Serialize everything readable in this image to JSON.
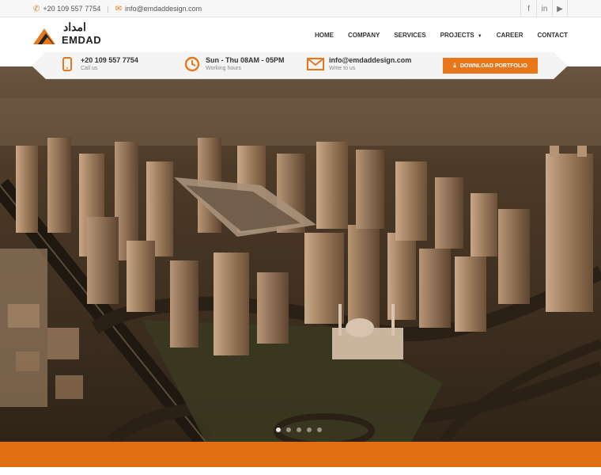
{
  "topbar": {
    "phone": "+20 109 557 7754",
    "email": "info@emdaddesign.com",
    "social": [
      "facebook-icon",
      "linkedin-icon",
      "youtube-icon"
    ],
    "social_glyphs": [
      "f",
      "in",
      "▶"
    ]
  },
  "header": {
    "logo_arabic": "امداد",
    "logo_latin": "EMDAD",
    "nav": [
      {
        "label": "HOME"
      },
      {
        "label": "COMPANY"
      },
      {
        "label": "SERVICES"
      },
      {
        "label": "PROJECTS"
      },
      {
        "label": "CAREER"
      },
      {
        "label": "CONTACT"
      }
    ]
  },
  "infoband": {
    "phone": {
      "title": "+20 109 557 7754",
      "subtitle": "Call us"
    },
    "hours": {
      "title": "Sun - Thu 08AM - 05PM",
      "subtitle": "Working hours"
    },
    "email": {
      "title": "info@emdaddesign.com",
      "subtitle": "Write to us"
    },
    "portfolio_button": "DOWNLOAD PORTFOLIO"
  },
  "slider": {
    "slide_count": 5,
    "active_slide": 1
  },
  "colors": {
    "accent": "#e8771b",
    "bar": "#e06f12"
  }
}
